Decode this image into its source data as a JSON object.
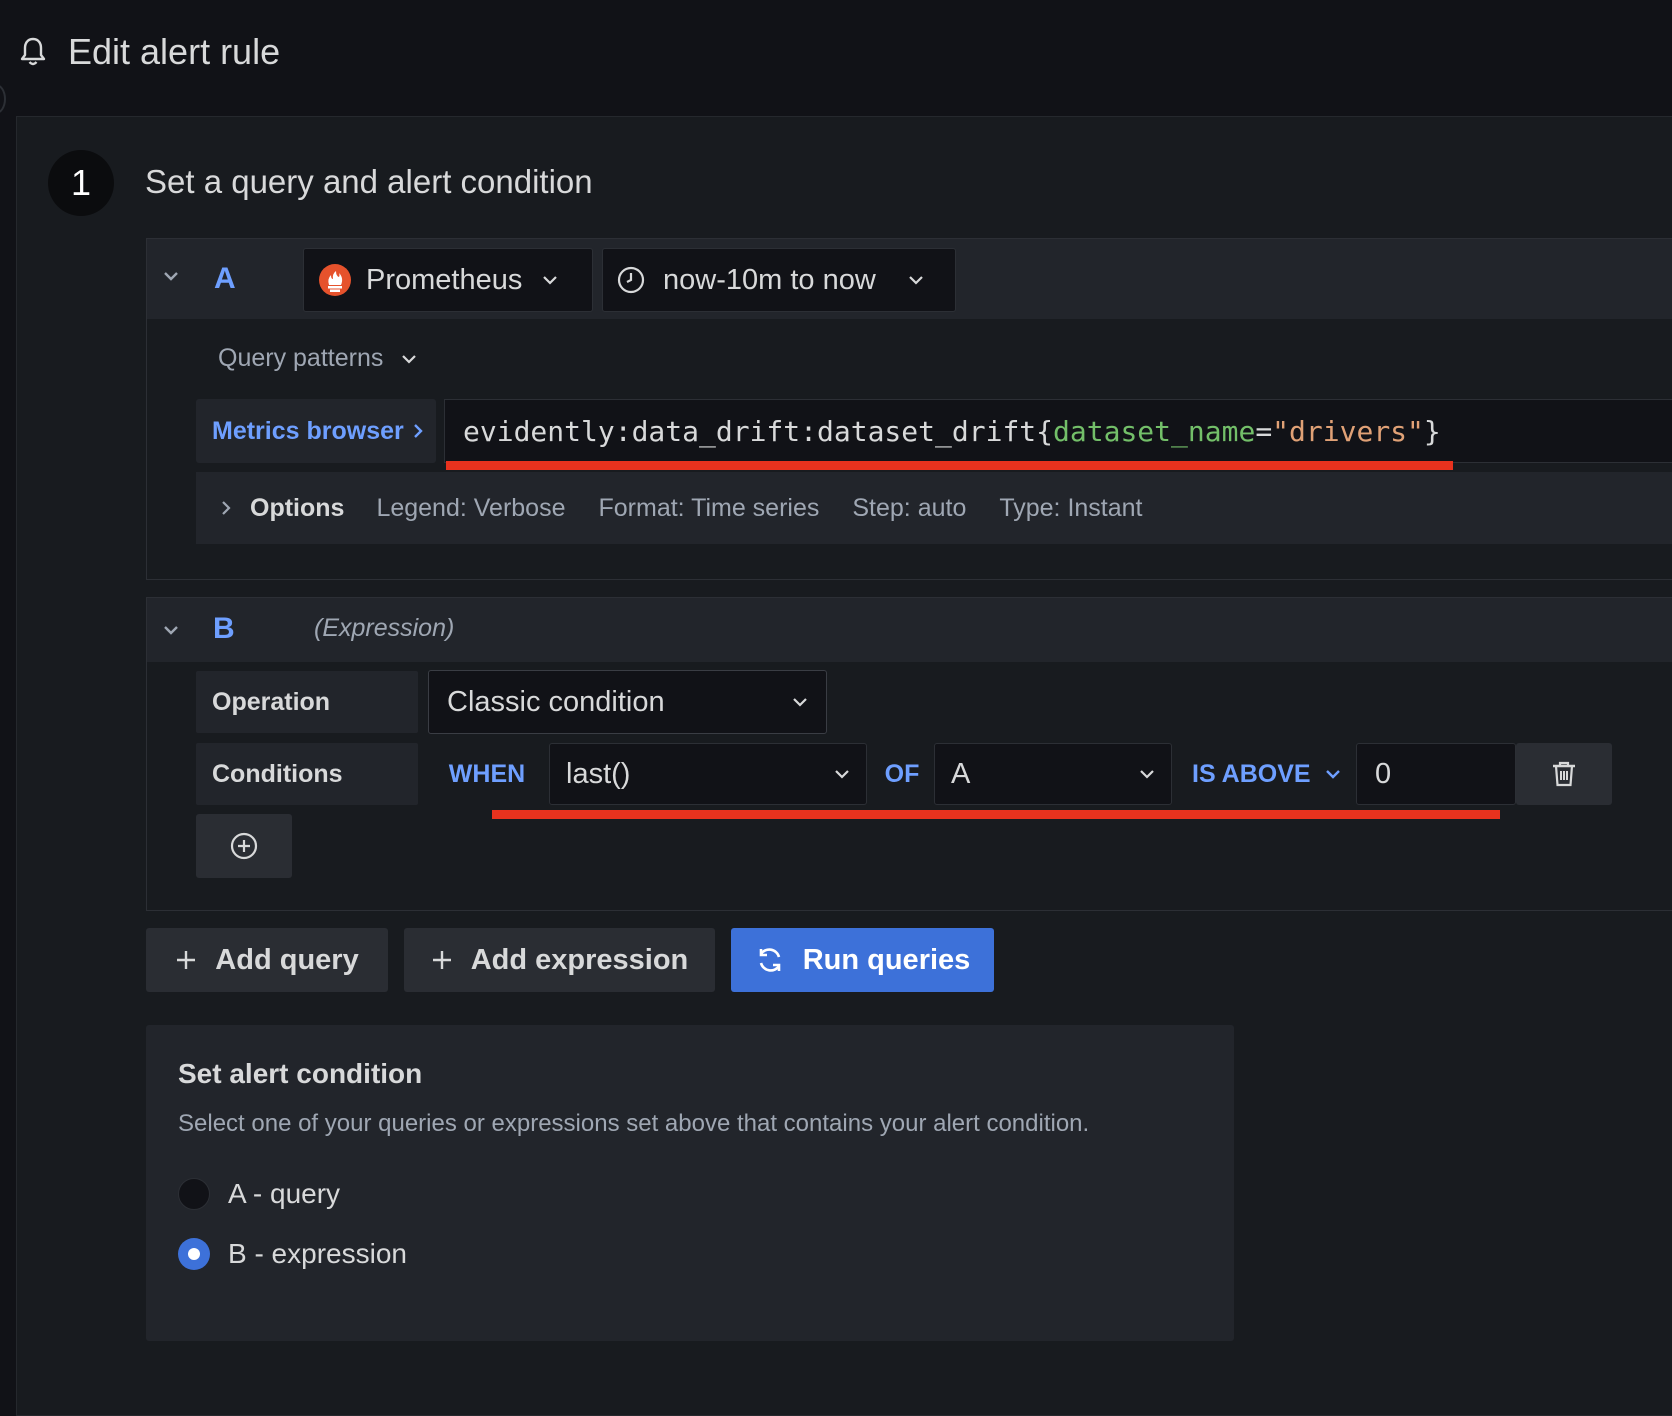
{
  "header": {
    "title": "Edit alert rule",
    "icon": "bell-icon"
  },
  "step": {
    "number": "1",
    "title": "Set a query and alert condition"
  },
  "query_a": {
    "ref_id": "A",
    "datasource": {
      "name": "Prometheus",
      "icon": "prometheus-logo"
    },
    "time_range": {
      "label": "now-10m to now",
      "icon": "clock-icon"
    },
    "query_patterns_label": "Query patterns",
    "metrics_browser_label": "Metrics browser",
    "expression": {
      "metric": "evidently:data_drift:dataset_drift",
      "open_brace": "{",
      "label_name": "dataset_name",
      "equals": "=",
      "label_value": "\"drivers\"",
      "close_brace": "}"
    },
    "options": {
      "title": "Options",
      "legend": "Legend: Verbose",
      "format": "Format: Time series",
      "step": "Step: auto",
      "type": "Type: Instant"
    }
  },
  "query_b": {
    "ref_id": "B",
    "type_label": "(Expression)",
    "operation_label": "Operation",
    "operation_value": "Classic condition",
    "conditions_label": "Conditions",
    "condition": {
      "when": "WHEN",
      "reducer": "last()",
      "of": "OF",
      "query": "A",
      "evaluator": "IS ABOVE",
      "threshold": "0"
    }
  },
  "actions": {
    "add_query": "Add query",
    "add_expression": "Add expression",
    "run_queries": "Run queries"
  },
  "alert_condition": {
    "title": "Set alert condition",
    "description": "Select one of your queries or expressions set above that contains your alert condition.",
    "options": [
      {
        "label": "A - query",
        "selected": false
      },
      {
        "label": "B - expression",
        "selected": true
      }
    ]
  },
  "colors": {
    "accent_blue": "#3d71d9",
    "ref_blue": "#6e9fff",
    "annotation_red": "#e8321e",
    "promql_label_green": "#73bf69",
    "promql_string_orange": "#e0a176"
  }
}
